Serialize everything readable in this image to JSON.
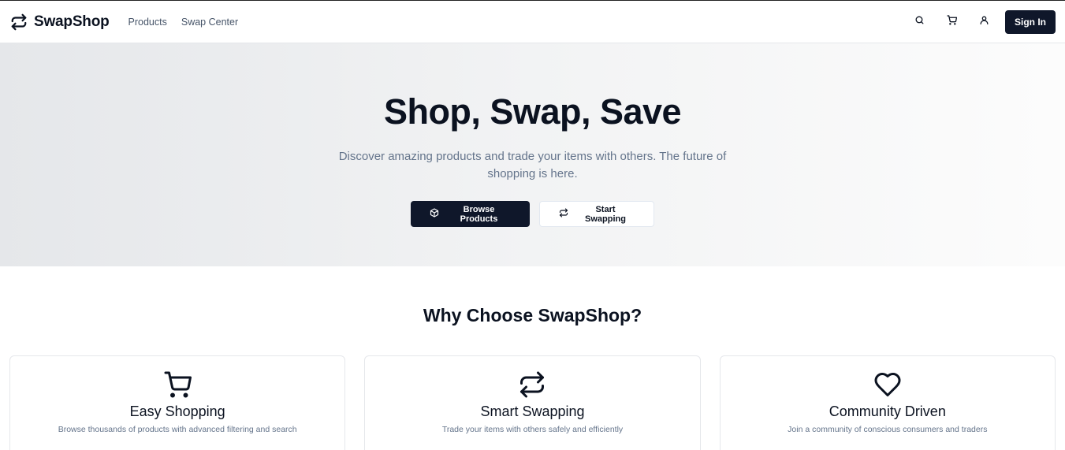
{
  "header": {
    "brand": "SwapShop",
    "nav": [
      {
        "label": "Products"
      },
      {
        "label": "Swap Center"
      }
    ],
    "icons": [
      "search-icon",
      "cart-icon",
      "user-icon"
    ],
    "signin_label": "Sign In"
  },
  "hero": {
    "title": "Shop, Swap, Save",
    "subtitle": "Discover amazing products and trade your items with others. The future of shopping is here.",
    "primary_label": "Browse Products",
    "secondary_label": "Start Swapping"
  },
  "features": {
    "heading": "Why Choose SwapShop?",
    "cards": [
      {
        "icon": "cart-icon",
        "title": "Easy Shopping",
        "desc": "Browse thousands of products with advanced filtering and search"
      },
      {
        "icon": "swap-icon",
        "title": "Smart Swapping",
        "desc": "Trade your items with others safely and efficiently"
      },
      {
        "icon": "heart-icon",
        "title": "Community Driven",
        "desc": "Join a community of conscious consumers and traders"
      }
    ]
  },
  "colors": {
    "primary": "#0f172a",
    "muted_text": "#64748b",
    "border": "#e5e7eb"
  }
}
